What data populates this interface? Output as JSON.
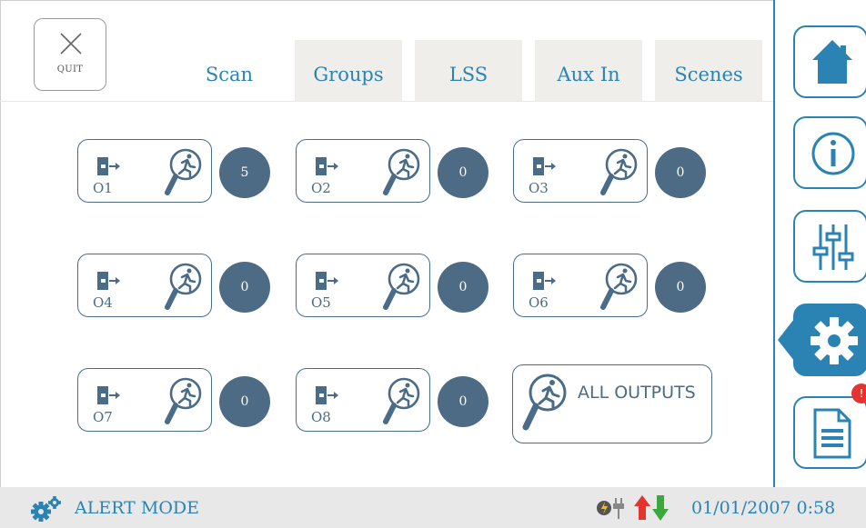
{
  "quit": {
    "label": "QUIT",
    "icon": "close-icon"
  },
  "tabs": [
    {
      "label": "Scan",
      "active": true
    },
    {
      "label": "Groups",
      "active": false
    },
    {
      "label": "LSS",
      "active": false
    },
    {
      "label": "Aux In",
      "active": false
    },
    {
      "label": "Scenes",
      "active": false
    }
  ],
  "outputs": [
    {
      "name": "O1",
      "count": "5"
    },
    {
      "name": "O2",
      "count": "0"
    },
    {
      "name": "O3",
      "count": "0"
    },
    {
      "name": "O4",
      "count": "0"
    },
    {
      "name": "O5",
      "count": "0"
    },
    {
      "name": "O6",
      "count": "0"
    },
    {
      "name": "O7",
      "count": "0"
    },
    {
      "name": "O8",
      "count": "0"
    }
  ],
  "all_outputs": {
    "label": "ALL OUTPUTS"
  },
  "sidebar": {
    "items": [
      {
        "icon": "home-icon"
      },
      {
        "icon": "info-icon"
      },
      {
        "icon": "sliders-icon"
      },
      {
        "icon": "gear-icon",
        "active": true
      },
      {
        "icon": "document-icon",
        "badge": "!"
      }
    ]
  },
  "status": {
    "mode": "ALERT MODE",
    "datetime": "01/01/2007 0:58",
    "icons": [
      "gears-icon",
      "power-plug-icon",
      "up-down-arrows-icon"
    ]
  },
  "colors": {
    "accent": "#2b83b3",
    "dark": "#4d6b84",
    "alert": "#e3342f",
    "arrow_up": "#e3342f",
    "arrow_down": "#3aa83a"
  }
}
